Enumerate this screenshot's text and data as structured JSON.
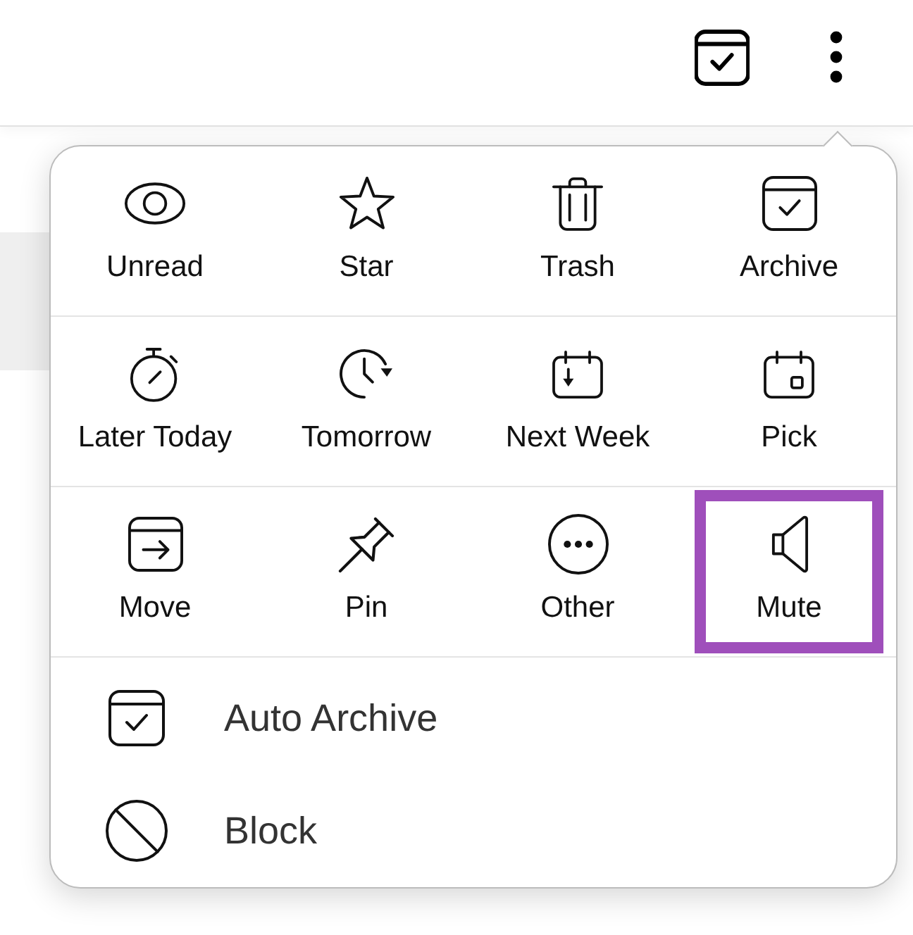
{
  "menu": {
    "actions": [
      {
        "kind": "unread",
        "label": "Unread",
        "selected": false
      },
      {
        "kind": "star",
        "label": "Star",
        "selected": false
      },
      {
        "kind": "trash",
        "label": "Trash",
        "selected": false
      },
      {
        "kind": "archive",
        "label": "Archive",
        "selected": false
      },
      {
        "kind": "later",
        "label": "Later Today",
        "selected": false
      },
      {
        "kind": "tomorrow",
        "label": "Tomorrow",
        "selected": false
      },
      {
        "kind": "nextweek",
        "label": "Next Week",
        "selected": false
      },
      {
        "kind": "pick",
        "label": "Pick",
        "selected": false
      },
      {
        "kind": "move",
        "label": "Move",
        "selected": false
      },
      {
        "kind": "pin",
        "label": "Pin",
        "selected": false
      },
      {
        "kind": "other",
        "label": "Other",
        "selected": false
      },
      {
        "kind": "mute",
        "label": "Mute",
        "selected": true
      }
    ],
    "options": [
      {
        "kind": "autoarchive",
        "label": "Auto Archive"
      },
      {
        "kind": "block",
        "label": "Block"
      }
    ]
  }
}
